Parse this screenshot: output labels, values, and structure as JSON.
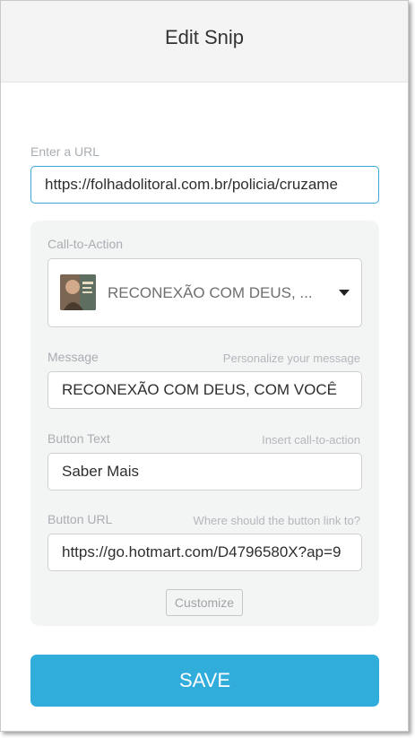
{
  "header": {
    "title": "Edit Snip"
  },
  "url_field": {
    "label": "Enter a URL",
    "value": "https://folhadolitoral.com.br/policia/cruzame"
  },
  "cta": {
    "label": "Call-to-Action",
    "selected": "RECONEXÃO COM DEUS, ...",
    "thumbnail_icon": "avatar-thumbnail",
    "dropdown_icon": "caret-down-icon"
  },
  "message": {
    "label": "Message",
    "hint": "Personalize your message",
    "value": "RECONEXÃO COM DEUS, COM VOCÊ"
  },
  "button_text": {
    "label": "Button Text",
    "hint": "Insert call-to-action",
    "value": "Saber Mais"
  },
  "button_url": {
    "label": "Button URL",
    "hint": "Where should the button link to?",
    "value": "https://go.hotmart.com/D4796580X?ap=9"
  },
  "customize_label": "Customize",
  "save_label": "SAVE",
  "colors": {
    "accent": "#31addc",
    "focus_border": "#3ba7d8",
    "card_bg": "#f3f4f4"
  }
}
